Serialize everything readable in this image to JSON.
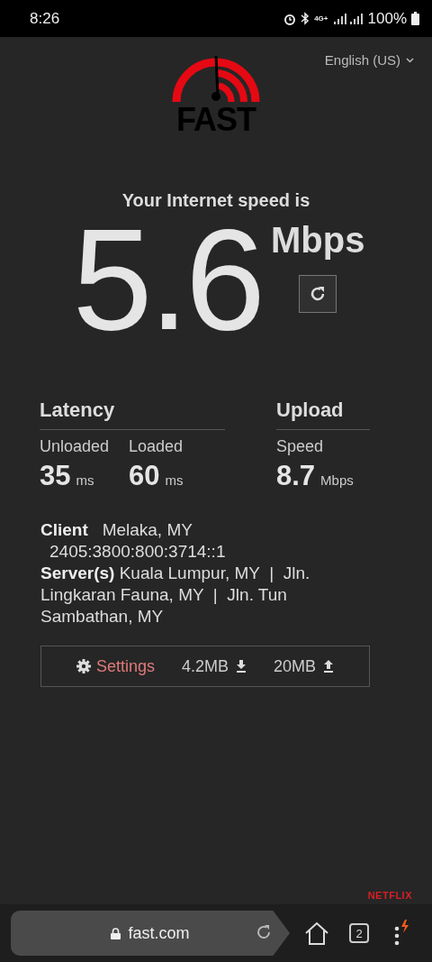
{
  "status_bar": {
    "time": "8:26",
    "battery": "100%",
    "network": "4G+"
  },
  "header": {
    "language": "English (US)",
    "logo_text": "FAST"
  },
  "result": {
    "caption": "Your Internet speed is",
    "speed": "5.6",
    "unit": "Mbps"
  },
  "latency": {
    "title": "Latency",
    "items": [
      {
        "label": "Unloaded",
        "value": "35",
        "unit": "ms"
      },
      {
        "label": "Loaded",
        "value": "60",
        "unit": "ms"
      }
    ]
  },
  "upload": {
    "title": "Upload",
    "items": [
      {
        "label": "Speed",
        "value": "8.7",
        "unit": "Mbps"
      }
    ]
  },
  "client": {
    "label": "Client",
    "location": "Melaka, MY",
    "ip": "2405:3800:800:3714::1"
  },
  "servers": "**Server(s)** Kuala Lumpur, MY  |  Jln. Lingkaran Fauna, MY  |  Jln. Tun Sambathan, MY",
  "footer_bar": {
    "settings": "Settings",
    "download_size": "4.2MB",
    "upload_size": "20MB"
  },
  "brand": "NETFLIX",
  "browser": {
    "url": "fast.com",
    "tab_count": "2"
  }
}
